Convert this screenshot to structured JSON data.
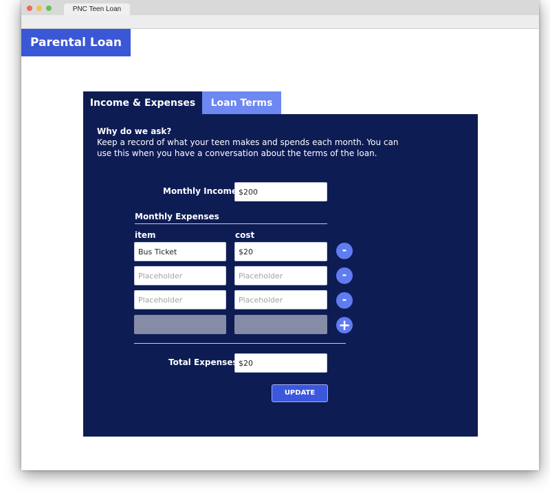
{
  "browser": {
    "tab_title": "PNC Teen Loan"
  },
  "brand": {
    "title": "Parental Loan",
    "color": "#3a57d6"
  },
  "tabs": [
    {
      "label": "Income & Expenses",
      "active": true
    },
    {
      "label": "Loan Terms",
      "active": false
    }
  ],
  "intro": {
    "title": "Why do we ask?",
    "text": "Keep a record of what your teen makes and spends each month. You can use this when you have a conversation about the terms of the loan."
  },
  "income": {
    "label": "Monthly Income",
    "value": "$200"
  },
  "expenses": {
    "section_title": "Monthly Expenses",
    "col_item": "item",
    "col_cost": "cost",
    "rows": [
      {
        "item": "Bus Ticket",
        "cost": "$20",
        "item_placeholder": "",
        "cost_placeholder": ""
      },
      {
        "item": "",
        "cost": "",
        "item_placeholder": "Placeholder",
        "cost_placeholder": "Placeholder"
      },
      {
        "item": "",
        "cost": "",
        "item_placeholder": "Placeholder",
        "cost_placeholder": "Placeholder"
      }
    ],
    "remove_label": "-",
    "add_label": "+"
  },
  "total": {
    "label": "Total Expenses",
    "value": "$20"
  },
  "update_button": "UPDATE",
  "colors": {
    "panel": "#0e1c54",
    "tab_inactive": "#6d87f3",
    "button": "#5f7cf0"
  }
}
